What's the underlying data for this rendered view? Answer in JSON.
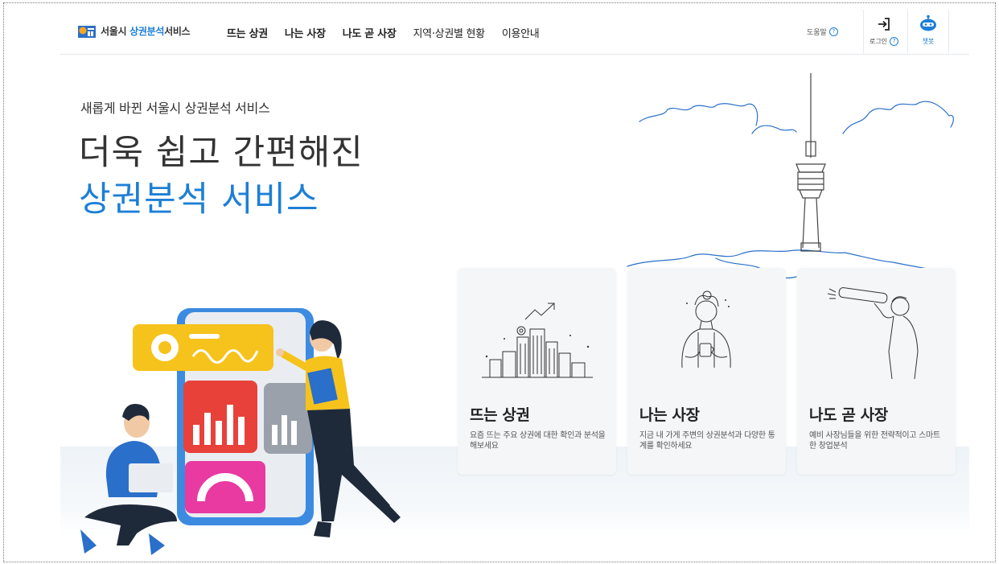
{
  "header": {
    "logo_text_prefix": "서울시 ",
    "logo_text_accent": "상권분석",
    "logo_text_suffix": "서비스",
    "nav": [
      {
        "label": "뜨는 상권",
        "bold": true
      },
      {
        "label": "나는 사장",
        "bold": true
      },
      {
        "label": "나도 곧 사장",
        "bold": true
      },
      {
        "label": "지역·상권별 현황",
        "bold": false
      },
      {
        "label": "이용안내",
        "bold": false
      }
    ],
    "help_label": "도움말",
    "login_label": "로그인",
    "chatbot_label": "챗봇"
  },
  "hero": {
    "subtitle": "새롭게 바뀐 서울시 상권분석 서비스",
    "title_line1": "더욱 쉽고 간편해진",
    "title_line2": "상권분석 서비스"
  },
  "cards": [
    {
      "title": "뜨는 상권",
      "desc": "요즘 뜨는 주요 상권에 대한 확인과 분석을 해보세요",
      "icon": "city-growth-icon"
    },
    {
      "title": "나는 사장",
      "desc": "지금 내 가게 주변의 상권분석과 다양한 통계를 확인하세요",
      "icon": "shop-owner-icon"
    },
    {
      "title": "나도 곧 사장",
      "desc": "예비 사장님들을 위한 전략적이고 스마트한 창업분석",
      "icon": "telescope-icon"
    }
  ],
  "colors": {
    "accent": "#1d7fd6",
    "logo_orange": "#f5a623",
    "yellow": "#f6c21c",
    "red": "#e8413a",
    "magenta": "#e83aa1",
    "blue_shirt": "#2a6fc9"
  }
}
